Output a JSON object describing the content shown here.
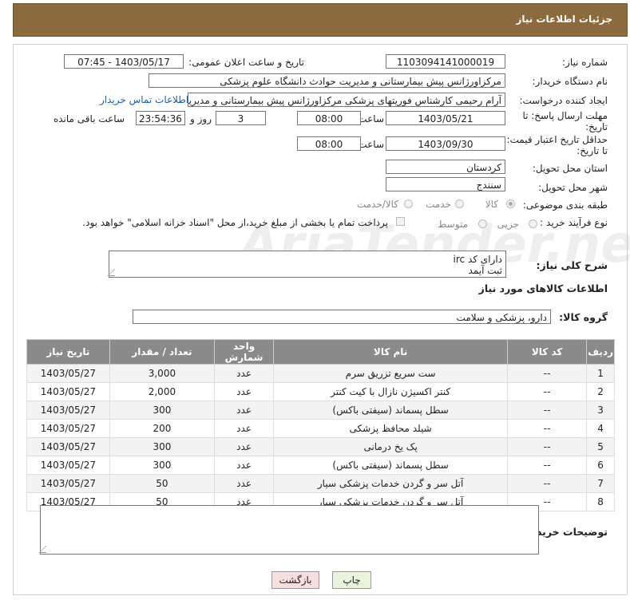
{
  "header": {
    "title": "جزئیات اطلاعات نیاز"
  },
  "form": {
    "need_number_label": "شماره نیاز:",
    "need_number": "1103094141000019",
    "announce_label": "تاریخ و ساعت اعلان عمومی:",
    "announce_value": "1403/05/17 - 07:45",
    "buyer_label": "نام دستگاه خریدار:",
    "buyer_value": "مرکزاورژانس پیش بیمارستانی و مدیریت حوادث دانشگاه علوم پزشکی",
    "creator_label": "ایجاد کننده درخواست:",
    "creator_value": "آرام رحیمی کارشناس فوریتهای پزشکی مرکزاورژانس پیش بیمارستانی و مدیریت",
    "contact_link": "اطلاعات تماس خریدار",
    "deadline_label": "مهلت ارسال پاسخ: تا تاریخ:",
    "deadline_date": "1403/05/21",
    "time_label": "ساعت",
    "deadline_time": "08:00",
    "days_value": "3",
    "days_label": "روز و",
    "remaining_value": "23:54:36",
    "remaining_label": "ساعت باقی مانده",
    "validity_label": "حداقل تاریخ اعتبار قیمت: تا تاریخ:",
    "validity_date": "1403/09/30",
    "validity_time": "08:00",
    "province_label": "استان محل تحویل:",
    "province_value": "کردستان",
    "city_label": "شهر محل تحویل:",
    "city_value": "سنندج",
    "category_label": "طبقه بندی موضوعی:",
    "category_options": [
      "کالا",
      "خدمت",
      "کالا/خدمت"
    ],
    "category_selected": "کالا",
    "process_label": "نوع فرآیند خرید :",
    "process_options": [
      "جزیی",
      "متوسط"
    ],
    "payment_note": "پرداخت تمام یا بخشی از مبلغ خرید،از محل \"اسناد خزانه اسلامی\" خواهد بود.",
    "desc_label": "شرح کلی نیاز:",
    "desc_line1": "دارای کد irc",
    "desc_line2": "ثبت آیمد",
    "goods_info_title": "اطلاعات کالاهای مورد نیاز",
    "goods_group_label": "گروه کالا:",
    "goods_group_value": "دارو، پزشکی و سلامت",
    "buyer_notes_label": "توضیحات خریدار:"
  },
  "table": {
    "headers": [
      "ردیف",
      "کد کالا",
      "نام کالا",
      "واحد شمارش",
      "تعداد / مقدار",
      "تاریخ نیاز"
    ],
    "rows": [
      [
        "1",
        "--",
        "ست سریع تزریق سرم",
        "عدد",
        "3,000",
        "1403/05/27"
      ],
      [
        "2",
        "--",
        "کنتر اکسیژن نازال با کیت کنتر",
        "عدد",
        "2,000",
        "1403/05/27"
      ],
      [
        "3",
        "--",
        "سطل پسماند (سیفتی باکس)",
        "عدد",
        "300",
        "1403/05/27"
      ],
      [
        "4",
        "--",
        "شیلد محافظ پزشکی",
        "عدد",
        "200",
        "1403/05/27"
      ],
      [
        "5",
        "--",
        "پک یخ درمانی",
        "عدد",
        "300",
        "1403/05/27"
      ],
      [
        "6",
        "--",
        "سطل پسماند (سیفتی باکس)",
        "عدد",
        "300",
        "1403/05/27"
      ],
      [
        "7",
        "--",
        "آتل سر و گردن خدمات پزشکی سیار",
        "عدد",
        "50",
        "1403/05/27"
      ],
      [
        "8",
        "--",
        "آتل سر و گردن خدمات پزشکی سیار",
        "عدد",
        "50",
        "1403/05/27"
      ]
    ]
  },
  "buttons": {
    "print": "چاپ",
    "back": "بازگشت"
  },
  "watermark": "AriaTender.neT"
}
